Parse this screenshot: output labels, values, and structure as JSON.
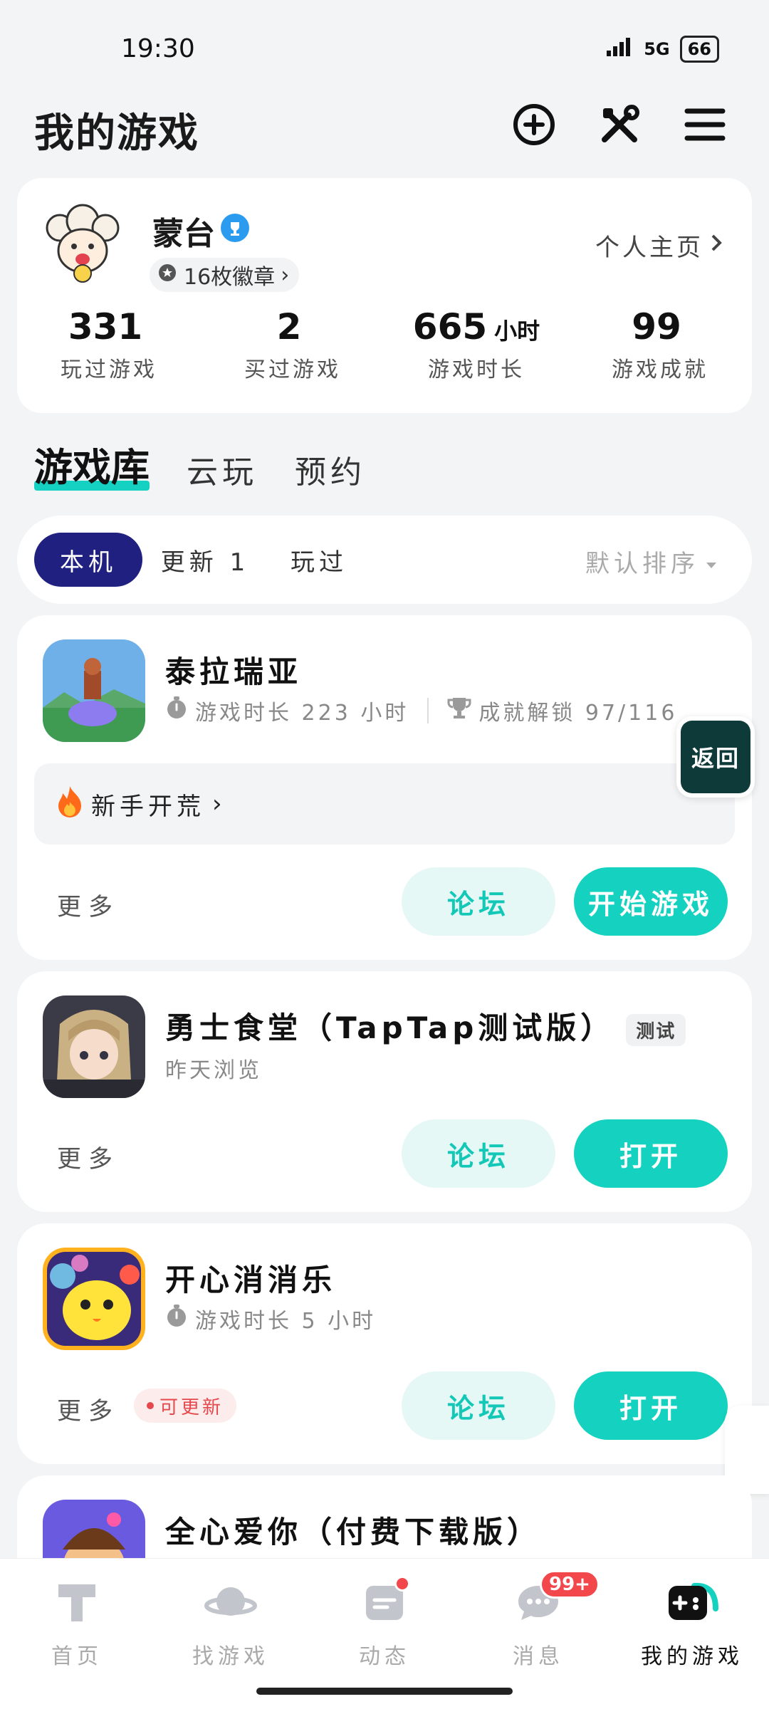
{
  "status_bar": {
    "time": "19:30",
    "network": "5G",
    "battery": "66"
  },
  "header": {
    "title": "我的游戏"
  },
  "profile": {
    "username": "蒙台",
    "badges": "16枚徽章",
    "homepage_link": "个人主页",
    "stats": [
      {
        "value": "331",
        "unit": "",
        "label": "玩过游戏"
      },
      {
        "value": "2",
        "unit": "",
        "label": "买过游戏"
      },
      {
        "value": "665",
        "unit": "小时",
        "label": "游戏时长"
      },
      {
        "value": "99",
        "unit": "",
        "label": "游戏成就"
      }
    ]
  },
  "library_tabs": [
    "游戏库",
    "云玩",
    "预约"
  ],
  "filters": {
    "chips": [
      "本机",
      "更新 1",
      "玩过"
    ],
    "sort": "默认排序"
  },
  "games": [
    {
      "name": "泰拉瑞亚",
      "playtime": "游戏时长 223 小时",
      "achievements": "成就解锁 97/116",
      "event": "新手开荒",
      "more": "更多",
      "forum": "论坛",
      "action": "开始游戏"
    },
    {
      "name": "勇士食堂（TapTap测试版）",
      "tag": "测试",
      "subtitle": "昨天浏览",
      "more": "更多",
      "forum": "论坛",
      "action": "打开"
    },
    {
      "name": "开心消消乐",
      "playtime": "游戏时长 5 小时",
      "update": "可更新",
      "more": "更多",
      "forum": "论坛",
      "action": "打开"
    },
    {
      "name": "全心爱你（付费下载版）"
    }
  ],
  "floating_back": "返回",
  "bottom_nav": {
    "items": [
      "首页",
      "找游戏",
      "动态",
      "消息",
      "我的游戏"
    ],
    "message_badge": "99+"
  },
  "colors": {
    "accent": "#14d2bf",
    "chip_active": "#1f2080",
    "badge_red": "#f2474b"
  }
}
